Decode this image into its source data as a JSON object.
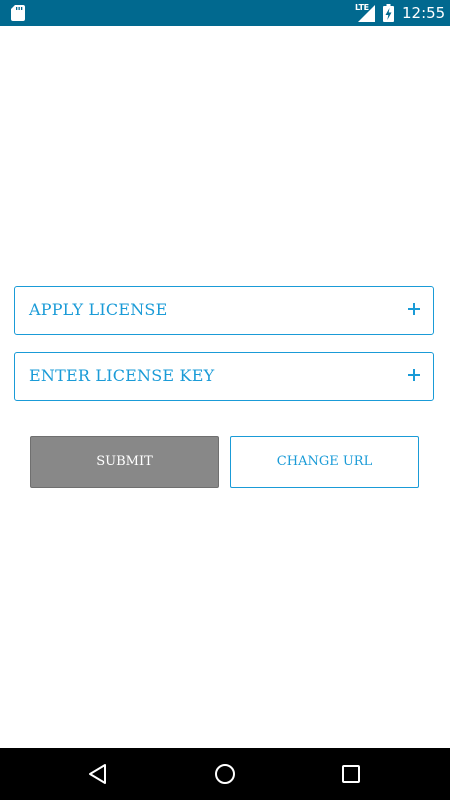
{
  "status_bar": {
    "network": "LTE",
    "time": "12:55",
    "background_color": "#01698f",
    "icons": [
      "sd-card-icon",
      "lte-signal-icon",
      "battery-charging-icon"
    ]
  },
  "rows": [
    {
      "label": "APPLY LICENSE",
      "icon": "plus-icon"
    },
    {
      "label": "ENTER LICENSE KEY",
      "icon": "plus-icon"
    }
  ],
  "buttons": {
    "submit": "SUBMIT",
    "change_url": "CHANGE URL"
  },
  "colors": {
    "accent": "#1a9bd7",
    "submit_bg": "#888888"
  },
  "nav_bar": {
    "icons": [
      "back-icon",
      "home-icon",
      "recents-icon"
    ]
  }
}
